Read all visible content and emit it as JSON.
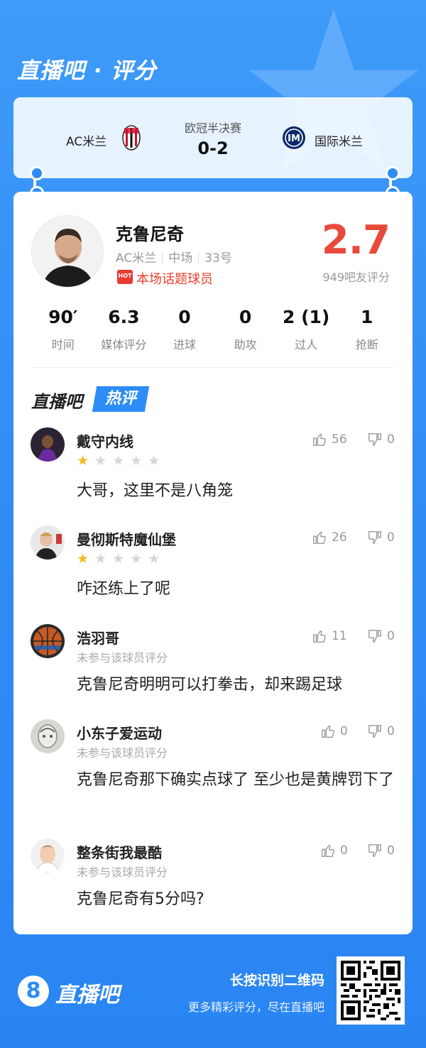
{
  "header": {
    "title": "直播吧 · 评分"
  },
  "match": {
    "home": "AC米兰",
    "away": "国际米兰",
    "competition": "欧冠半决赛",
    "score": "0-2"
  },
  "player": {
    "name": "克鲁尼奇",
    "team": "AC米兰",
    "position": "中场",
    "number": "33号",
    "hot_badge": "HOT",
    "hot_label": "本场话题球员",
    "rating": "2.7",
    "rating_count": "949吧友评分"
  },
  "stats": [
    {
      "value": "90′",
      "label": "时间"
    },
    {
      "value": "6.3",
      "label": "媒体评分"
    },
    {
      "value": "0",
      "label": "进球"
    },
    {
      "value": "0",
      "label": "助攻"
    },
    {
      "value": "2 (1)",
      "label": "过人"
    },
    {
      "value": "1",
      "label": "抢断"
    }
  ],
  "hot_comments": {
    "title": "直播吧",
    "badge": "热评",
    "items": [
      {
        "user": "戴守内线",
        "stars": 1,
        "sub": "",
        "text": "大哥，这里不是八角笼",
        "likes": "56",
        "dislikes": "0"
      },
      {
        "user": "曼彻斯特魔仙堡",
        "stars": 1,
        "sub": "",
        "text": "咋还练上了呢",
        "likes": "26",
        "dislikes": "0"
      },
      {
        "user": "浩羽哥",
        "stars": 0,
        "sub": "未参与该球员评分",
        "text": "克鲁尼奇明明可以打拳击，却来踢足球",
        "likes": "11",
        "dislikes": "0"
      },
      {
        "user": "小东子爱运动",
        "stars": 0,
        "sub": "未参与该球员评分",
        "text": "克鲁尼奇那下确实点球了 至少也是黄牌罚下了",
        "likes": "0",
        "dislikes": "0"
      },
      {
        "user": "整条街我最酷",
        "stars": 0,
        "sub": "未参与该球员评分",
        "text": "克鲁尼奇有5分吗?",
        "likes": "0",
        "dislikes": "0"
      }
    ]
  },
  "footer": {
    "logo_glyph": "8",
    "brand": "直播吧",
    "line1": "长按识别二维码",
    "line2": "更多精彩评分，尽在直播吧"
  },
  "colors": {
    "brand_blue": "#2d8cf6",
    "rating_red": "#e74a3b",
    "star_gold": "#f5b91f"
  }
}
